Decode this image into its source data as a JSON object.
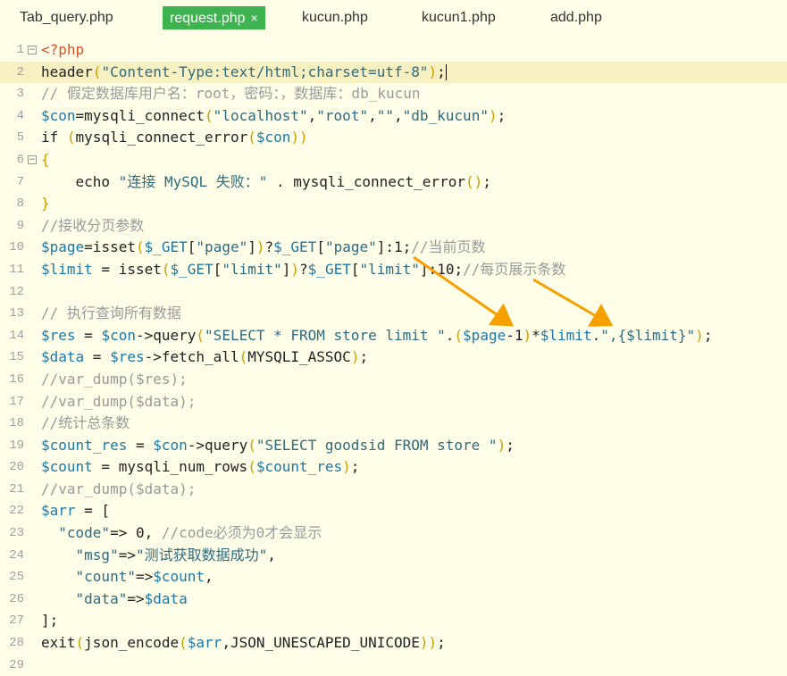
{
  "tabs": [
    {
      "label": "Tab_query.php",
      "active": false
    },
    {
      "label": "request.php",
      "active": true,
      "close": "×"
    },
    {
      "label": "kucun.php",
      "active": false
    },
    {
      "label": "kucun1.php",
      "active": false
    },
    {
      "label": "add.php",
      "active": false
    }
  ],
  "colors": {
    "accent": "#3fb34f",
    "background": "#fdfde8",
    "current_line": "#f7f0c2",
    "arrow": "#f5a000"
  },
  "lines": [
    {
      "n": "1",
      "fold": "⊟",
      "segs": [
        [
          "t-tag",
          "<?php"
        ]
      ]
    },
    {
      "n": "2",
      "current": true,
      "cursor": true,
      "segs": [
        [
          "t-plain",
          "header"
        ],
        [
          "t-par",
          "("
        ],
        [
          "t-str",
          "\"Content-Type:text/html;charset=utf-8\""
        ],
        [
          "t-par",
          ")"
        ],
        [
          "t-plain",
          ";"
        ]
      ]
    },
    {
      "n": "3",
      "segs": [
        [
          "t-com",
          "// 假定数据库用户名：root，密码：，数据库：db_kucun"
        ]
      ]
    },
    {
      "n": "4",
      "segs": [
        [
          "t-var",
          "$con"
        ],
        [
          "t-plain",
          "=mysqli_connect"
        ],
        [
          "t-par",
          "("
        ],
        [
          "t-str",
          "\"localhost\""
        ],
        [
          "t-plain",
          ","
        ],
        [
          "t-str",
          "\"root\""
        ],
        [
          "t-plain",
          ","
        ],
        [
          "t-str",
          "\"\""
        ],
        [
          "t-plain",
          ","
        ],
        [
          "t-str",
          "\"db_kucun\""
        ],
        [
          "t-par",
          ")"
        ],
        [
          "t-plain",
          ";"
        ]
      ]
    },
    {
      "n": "5",
      "segs": [
        [
          "t-plain",
          "if "
        ],
        [
          "t-par",
          "("
        ],
        [
          "t-plain",
          "mysqli_connect_error"
        ],
        [
          "t-par",
          "("
        ],
        [
          "t-var",
          "$con"
        ],
        [
          "t-par",
          "))"
        ]
      ]
    },
    {
      "n": "6",
      "fold": "⊟",
      "segs": [
        [
          "t-par",
          "{"
        ]
      ]
    },
    {
      "n": "7",
      "segs": [
        [
          "t-plain",
          "    echo "
        ],
        [
          "t-str",
          "\"连接 MySQL 失败：\""
        ],
        [
          "t-plain",
          " . mysqli_connect_error"
        ],
        [
          "t-par",
          "()"
        ],
        [
          "t-plain",
          ";"
        ]
      ]
    },
    {
      "n": "8",
      "segs": [
        [
          "t-par",
          "}"
        ]
      ]
    },
    {
      "n": "9",
      "segs": [
        [
          "t-com",
          "//接收分页参数"
        ]
      ]
    },
    {
      "n": "10",
      "segs": [
        [
          "t-var",
          "$page"
        ],
        [
          "t-plain",
          "=isset"
        ],
        [
          "t-par",
          "("
        ],
        [
          "t-var",
          "$_GET"
        ],
        [
          "t-plain",
          "["
        ],
        [
          "t-str",
          "\"page\""
        ],
        [
          "t-plain",
          "]"
        ],
        [
          "t-par",
          ")"
        ],
        [
          "t-plain",
          "?"
        ],
        [
          "t-var",
          "$_GET"
        ],
        [
          "t-plain",
          "["
        ],
        [
          "t-str",
          "\"page\""
        ],
        [
          "t-plain",
          "]:1;"
        ],
        [
          "t-com",
          "//当前页数"
        ]
      ]
    },
    {
      "n": "11",
      "segs": [
        [
          "t-var",
          "$limit"
        ],
        [
          "t-plain",
          " = isset"
        ],
        [
          "t-par",
          "("
        ],
        [
          "t-var",
          "$_GET"
        ],
        [
          "t-plain",
          "["
        ],
        [
          "t-str",
          "\"limit\""
        ],
        [
          "t-plain",
          "]"
        ],
        [
          "t-par",
          ")"
        ],
        [
          "t-plain",
          "?"
        ],
        [
          "t-var",
          "$_GET"
        ],
        [
          "t-plain",
          "["
        ],
        [
          "t-str",
          "\"limit\""
        ],
        [
          "t-plain",
          "]:10;"
        ],
        [
          "t-com",
          "//每页展示条数"
        ]
      ]
    },
    {
      "n": "12",
      "segs": []
    },
    {
      "n": "13",
      "segs": [
        [
          "t-com",
          "// 执行查询所有数据"
        ]
      ]
    },
    {
      "n": "14",
      "segs": [
        [
          "t-var",
          "$res"
        ],
        [
          "t-plain",
          " = "
        ],
        [
          "t-var",
          "$con"
        ],
        [
          "t-plain",
          "->query"
        ],
        [
          "t-par",
          "("
        ],
        [
          "t-str",
          "\"SELECT * FROM store limit \""
        ],
        [
          "t-plain",
          "."
        ],
        [
          "t-par",
          "("
        ],
        [
          "t-var",
          "$page"
        ],
        [
          "t-plain",
          "-1"
        ],
        [
          "t-par",
          ")"
        ],
        [
          "t-plain",
          "*"
        ],
        [
          "t-var",
          "$limit"
        ],
        [
          "t-plain",
          "."
        ],
        [
          "t-str",
          "\",{$limit}\""
        ],
        [
          "t-par",
          ")"
        ],
        [
          "t-plain",
          ";"
        ]
      ]
    },
    {
      "n": "15",
      "segs": [
        [
          "t-var",
          "$data"
        ],
        [
          "t-plain",
          " = "
        ],
        [
          "t-var",
          "$res"
        ],
        [
          "t-plain",
          "->fetch_all"
        ],
        [
          "t-par",
          "("
        ],
        [
          "t-plain",
          "MYSQLI_ASSOC"
        ],
        [
          "t-par",
          ")"
        ],
        [
          "t-plain",
          ";"
        ]
      ]
    },
    {
      "n": "16",
      "segs": [
        [
          "t-com",
          "//var_dump($res);"
        ]
      ]
    },
    {
      "n": "17",
      "segs": [
        [
          "t-com",
          "//var_dump($data);"
        ]
      ]
    },
    {
      "n": "18",
      "segs": [
        [
          "t-com",
          "//统计总条数"
        ]
      ]
    },
    {
      "n": "19",
      "segs": [
        [
          "t-var",
          "$count_res"
        ],
        [
          "t-plain",
          " = "
        ],
        [
          "t-var",
          "$con"
        ],
        [
          "t-plain",
          "->query"
        ],
        [
          "t-par",
          "("
        ],
        [
          "t-str",
          "\"SELECT goodsid FROM store \""
        ],
        [
          "t-par",
          ")"
        ],
        [
          "t-plain",
          ";"
        ]
      ]
    },
    {
      "n": "20",
      "segs": [
        [
          "t-var",
          "$count"
        ],
        [
          "t-plain",
          " = mysqli_num_rows"
        ],
        [
          "t-par",
          "("
        ],
        [
          "t-var",
          "$count_res"
        ],
        [
          "t-par",
          ")"
        ],
        [
          "t-plain",
          ";"
        ]
      ]
    },
    {
      "n": "21",
      "segs": [
        [
          "t-com",
          "//var_dump($data);"
        ]
      ]
    },
    {
      "n": "22",
      "segs": [
        [
          "t-var",
          "$arr"
        ],
        [
          "t-plain",
          " = ["
        ]
      ]
    },
    {
      "n": "23",
      "segs": [
        [
          "t-plain",
          "  "
        ],
        [
          "t-str",
          "\"code\""
        ],
        [
          "t-plain",
          "=> 0, "
        ],
        [
          "t-com",
          "//code必须为0才会显示"
        ]
      ]
    },
    {
      "n": "24",
      "segs": [
        [
          "t-plain",
          "    "
        ],
        [
          "t-str",
          "\"msg\""
        ],
        [
          "t-plain",
          "=>"
        ],
        [
          "t-str",
          "\"测试获取数据成功\""
        ],
        [
          "t-plain",
          ","
        ]
      ]
    },
    {
      "n": "25",
      "segs": [
        [
          "t-plain",
          "    "
        ],
        [
          "t-str",
          "\"count\""
        ],
        [
          "t-plain",
          "=>"
        ],
        [
          "t-var",
          "$count"
        ],
        [
          "t-plain",
          ","
        ]
      ]
    },
    {
      "n": "26",
      "segs": [
        [
          "t-plain",
          "    "
        ],
        [
          "t-str",
          "\"data\""
        ],
        [
          "t-plain",
          "=>"
        ],
        [
          "t-var",
          "$data"
        ]
      ]
    },
    {
      "n": "27",
      "segs": [
        [
          "t-plain",
          "];"
        ]
      ]
    },
    {
      "n": "28",
      "segs": [
        [
          "t-plain",
          "exit"
        ],
        [
          "t-par",
          "("
        ],
        [
          "t-plain",
          "json_encode"
        ],
        [
          "t-par",
          "("
        ],
        [
          "t-var",
          "$arr"
        ],
        [
          "t-plain",
          ",JSON_UNESCAPED_UNICODE"
        ],
        [
          "t-par",
          "))"
        ],
        [
          "t-plain",
          ";"
        ]
      ]
    },
    {
      "n": "29",
      "segs": []
    }
  ]
}
